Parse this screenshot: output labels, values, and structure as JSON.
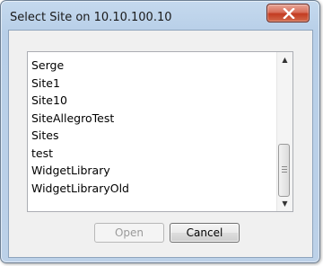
{
  "dialog": {
    "title": "Select Site on 10.10.100.10",
    "close_icon": "close-x-icon"
  },
  "list": {
    "items": [
      "Serge",
      "Site1",
      "Site10",
      "SiteAllegroTest",
      "Sites",
      "test",
      "WidgetLibrary",
      "WidgetLibraryOld"
    ],
    "scroll_up_icon": "scroll-up-arrow-icon",
    "scroll_down_icon": "scroll-down-arrow-icon",
    "scroll_position": 0.8
  },
  "buttons": {
    "open_label": "Open",
    "open_enabled": false,
    "cancel_label": "Cancel"
  },
  "colors": {
    "close_button": "#c8472d",
    "frame": "#bcd1e8"
  }
}
